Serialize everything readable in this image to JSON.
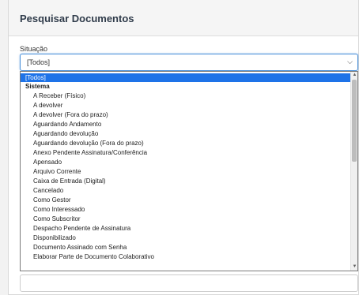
{
  "panel": {
    "title": "Pesquisar Documentos"
  },
  "situacao": {
    "label": "Situação",
    "selected_value": "[Todos]"
  },
  "dropdown": {
    "options": [
      {
        "label": "[Todos]",
        "kind": "selected"
      },
      {
        "label": "Sistema",
        "kind": "group"
      },
      {
        "label": "A Receber (Físico)",
        "kind": "child"
      },
      {
        "label": "A devolver",
        "kind": "child"
      },
      {
        "label": "A devolver (Fora do prazo)",
        "kind": "child"
      },
      {
        "label": "Aguardando Andamento",
        "kind": "child"
      },
      {
        "label": "Aguardando devolução",
        "kind": "child"
      },
      {
        "label": "Aguardando devolução (Fora do prazo)",
        "kind": "child"
      },
      {
        "label": "Anexo Pendente Assinatura/Conferência",
        "kind": "child"
      },
      {
        "label": "Apensado",
        "kind": "child"
      },
      {
        "label": "Arquivo Corrente",
        "kind": "child"
      },
      {
        "label": "Caixa de Entrada (Digital)",
        "kind": "child"
      },
      {
        "label": "Cancelado",
        "kind": "child"
      },
      {
        "label": "Como Gestor",
        "kind": "child"
      },
      {
        "label": "Como Interessado",
        "kind": "child"
      },
      {
        "label": "Como Subscritor",
        "kind": "child"
      },
      {
        "label": "Despacho Pendente de Assinatura",
        "kind": "child"
      },
      {
        "label": "Disponibilizado",
        "kind": "child"
      },
      {
        "label": "Documento Assinado com Senha",
        "kind": "child"
      },
      {
        "label": "Elaborar Parte de Documento Colaborativo",
        "kind": "child"
      }
    ],
    "scroll_position": 0.0
  },
  "icons": {
    "select_chevron": "chevron-down-icon",
    "scroll_up": "triangle-up-icon",
    "scroll_down": "triangle-down-icon"
  },
  "colors": {
    "accent": "#1e73e8",
    "focus_border": "#4a90d9"
  }
}
